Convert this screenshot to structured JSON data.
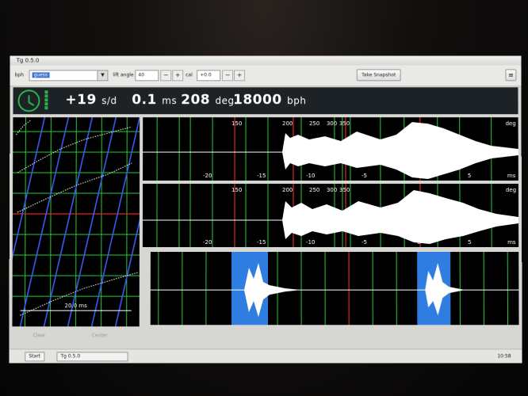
{
  "window": {
    "title": "Tg 0.5.0"
  },
  "toolbar": {
    "bph_label": "bph",
    "bph_value": "guess",
    "lift_label": "lift angle",
    "lift_value": "40",
    "cal_label": "cal",
    "cal_value": "+0.0",
    "minus": "−",
    "plus": "+",
    "snapshot_label": "Take Snapshot",
    "menu_icon": "hamburger-icon"
  },
  "status": {
    "rate": "+19",
    "rate_unit": "s/d",
    "beat_error": "0.1",
    "beat_error_unit": "ms",
    "amplitude": "208",
    "amplitude_unit": "deg",
    "beat_rate": "18000",
    "beat_rate_unit": "bph",
    "indicator_icon": "clock-icon"
  },
  "paper": {
    "scale_label": "20.0 ms",
    "clear_label": "Clear",
    "center_label": "Center"
  },
  "waveforms": {
    "top": {
      "unit_right_top": "deg",
      "unit_right_bottom": "ms",
      "deg_ticks": [
        "150",
        "200",
        "250",
        "300",
        "350"
      ],
      "ms_ticks": [
        "-20",
        "-15",
        "-10",
        "-5",
        "0",
        "5"
      ]
    },
    "middle": {
      "unit_right_top": "deg",
      "unit_right_bottom": "ms",
      "deg_ticks": [
        "150",
        "200",
        "250",
        "300",
        "350"
      ],
      "ms_ticks": [
        "-20",
        "-15",
        "-10",
        "-5",
        "0",
        "5"
      ]
    }
  },
  "taskbar": {
    "start_label": "Start",
    "task_label": "Tg 0.5.0",
    "clock": "10:58"
  },
  "colors": {
    "accent_green": "#2bb34a",
    "grid_green": "#22cc33",
    "grid_red": "#e0232b",
    "highlight_blue": "#2f7de0"
  }
}
